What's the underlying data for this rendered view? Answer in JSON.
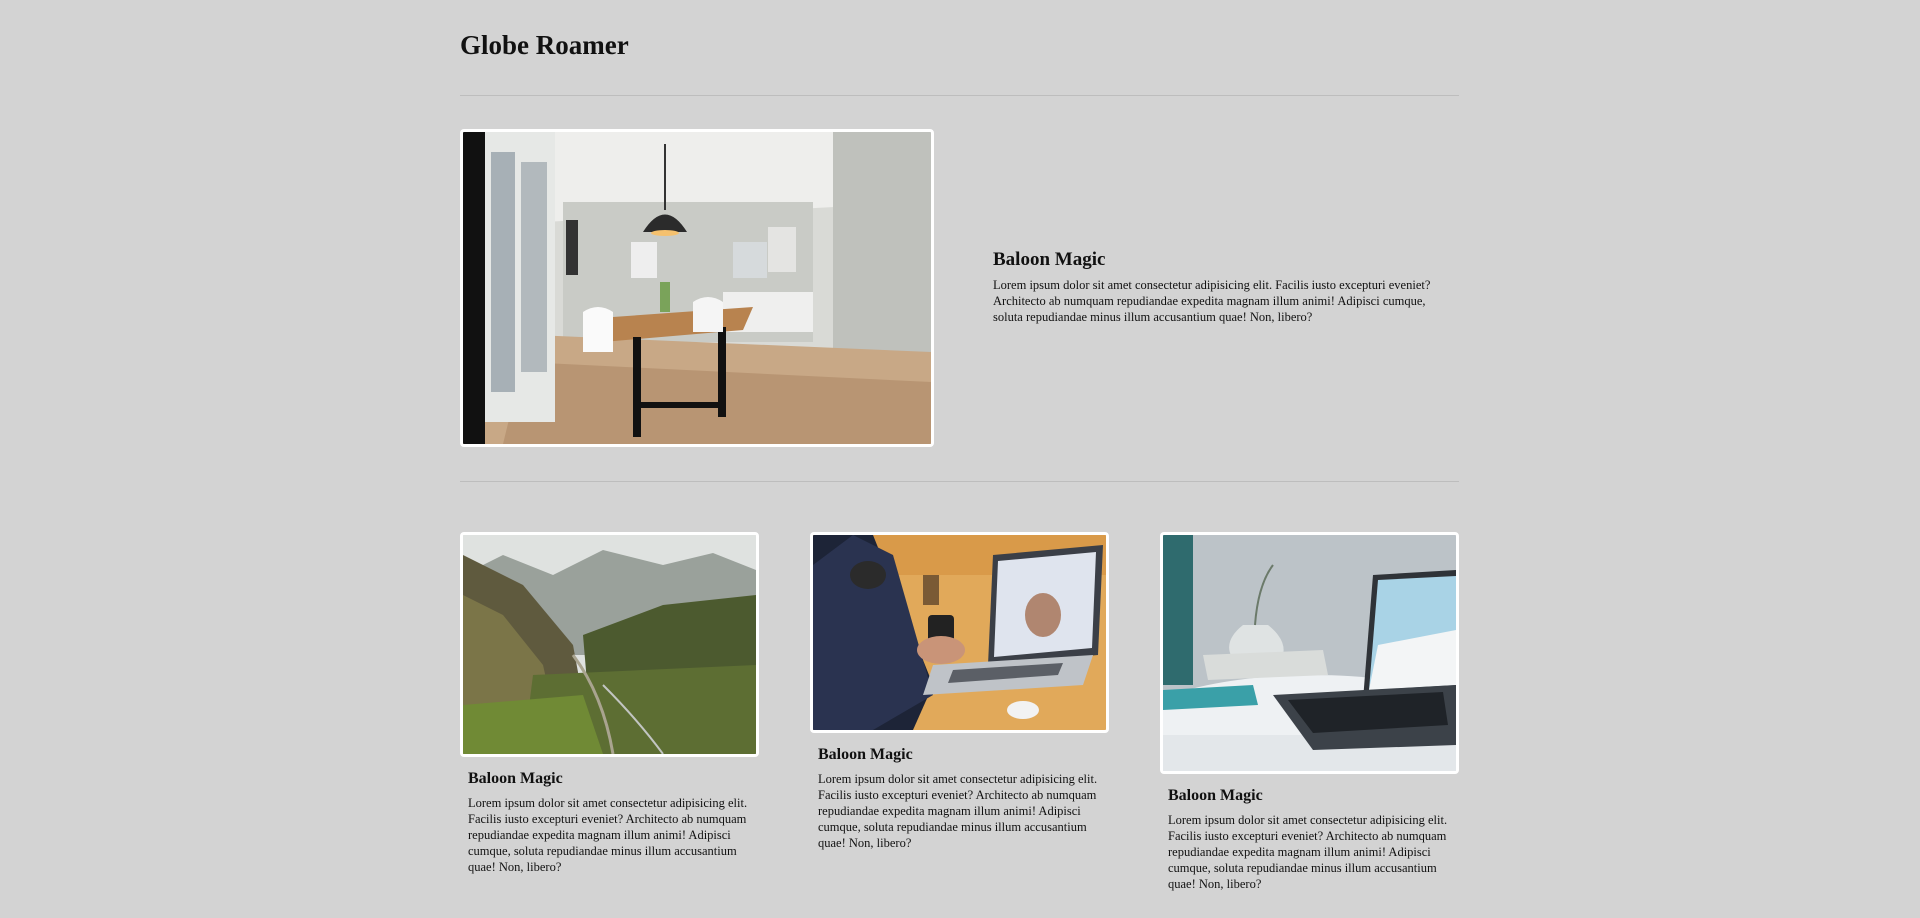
{
  "header": {
    "title": "Globe Roamer"
  },
  "featured": {
    "image_icon": "dining-room-photo",
    "title": "Baloon Magic",
    "body": "Lorem ipsum dolor sit amet consectetur adipisicing elit. Facilis iusto excepturi eveniet? Architecto ab numquam repudiandae expedita magnam illum animi! Adipisci cumque, soluta repudiandae minus illum accusantium quae! Non, libero?"
  },
  "cards": [
    {
      "image_icon": "mountain-valley-photo",
      "title": "Baloon Magic",
      "body": "Lorem ipsum dolor sit amet consectetur adipisicing elit. Facilis iusto excepturi eveniet? Architecto ab numquam repudiandae expedita magnam illum animi! Adipisci cumque, soluta repudiandae minus illum accusantium quae! Non, libero?"
    },
    {
      "image_icon": "laptop-desk-photo",
      "title": "Baloon Magic",
      "body": "Lorem ipsum dolor sit amet consectetur adipisicing elit. Facilis iusto excepturi eveniet? Architecto ab numquam repudiandae expedita magnam illum animi! Adipisci cumque, soluta repudiandae minus illum accusantium quae! Non, libero?"
    },
    {
      "image_icon": "laptop-vase-photo",
      "title": "Baloon Magic",
      "body": "Lorem ipsum dolor sit amet consectetur adipisicing elit. Facilis iusto excepturi eveniet? Architecto ab numquam repudiandae expedita magnam illum animi! Adipisci cumque, soluta repudiandae minus illum accusantium quae! Non, libero?"
    }
  ],
  "colors": {
    "page_background": "#d3d3d3",
    "divider": "#bdbdbd",
    "image_border": "#ffffff",
    "text": "#111111"
  }
}
